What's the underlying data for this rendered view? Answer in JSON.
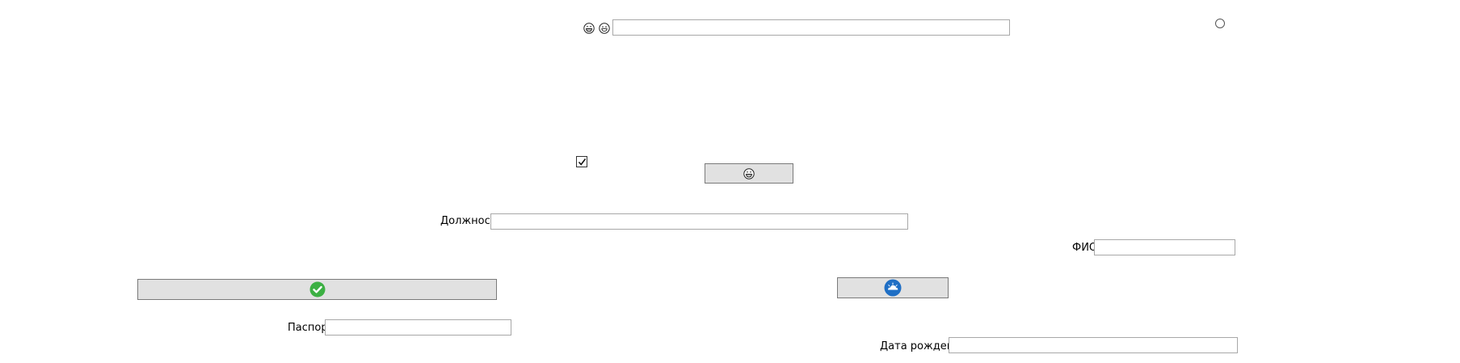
{
  "top": {
    "icon_1": "grinning-face-icon",
    "icon_2": "smiling-face-icon",
    "input_value": ""
  },
  "checkbox": {
    "checked": true
  },
  "radio": {
    "checked": false
  },
  "emoji_button": {
    "icon": "grinning-face-icon"
  },
  "position": {
    "label": "Должность",
    "value": ""
  },
  "fio": {
    "label": "ФИО",
    "value": ""
  },
  "confirm_button": {
    "icon": "green-check-icon",
    "color": "#3cb043"
  },
  "cloud_button": {
    "icon": "blue-cloud-icon",
    "color": "#1f6fc5"
  },
  "passport": {
    "label": "Паспорт",
    "value": ""
  },
  "birth_date": {
    "label": "Дата рождения",
    "value": ""
  }
}
